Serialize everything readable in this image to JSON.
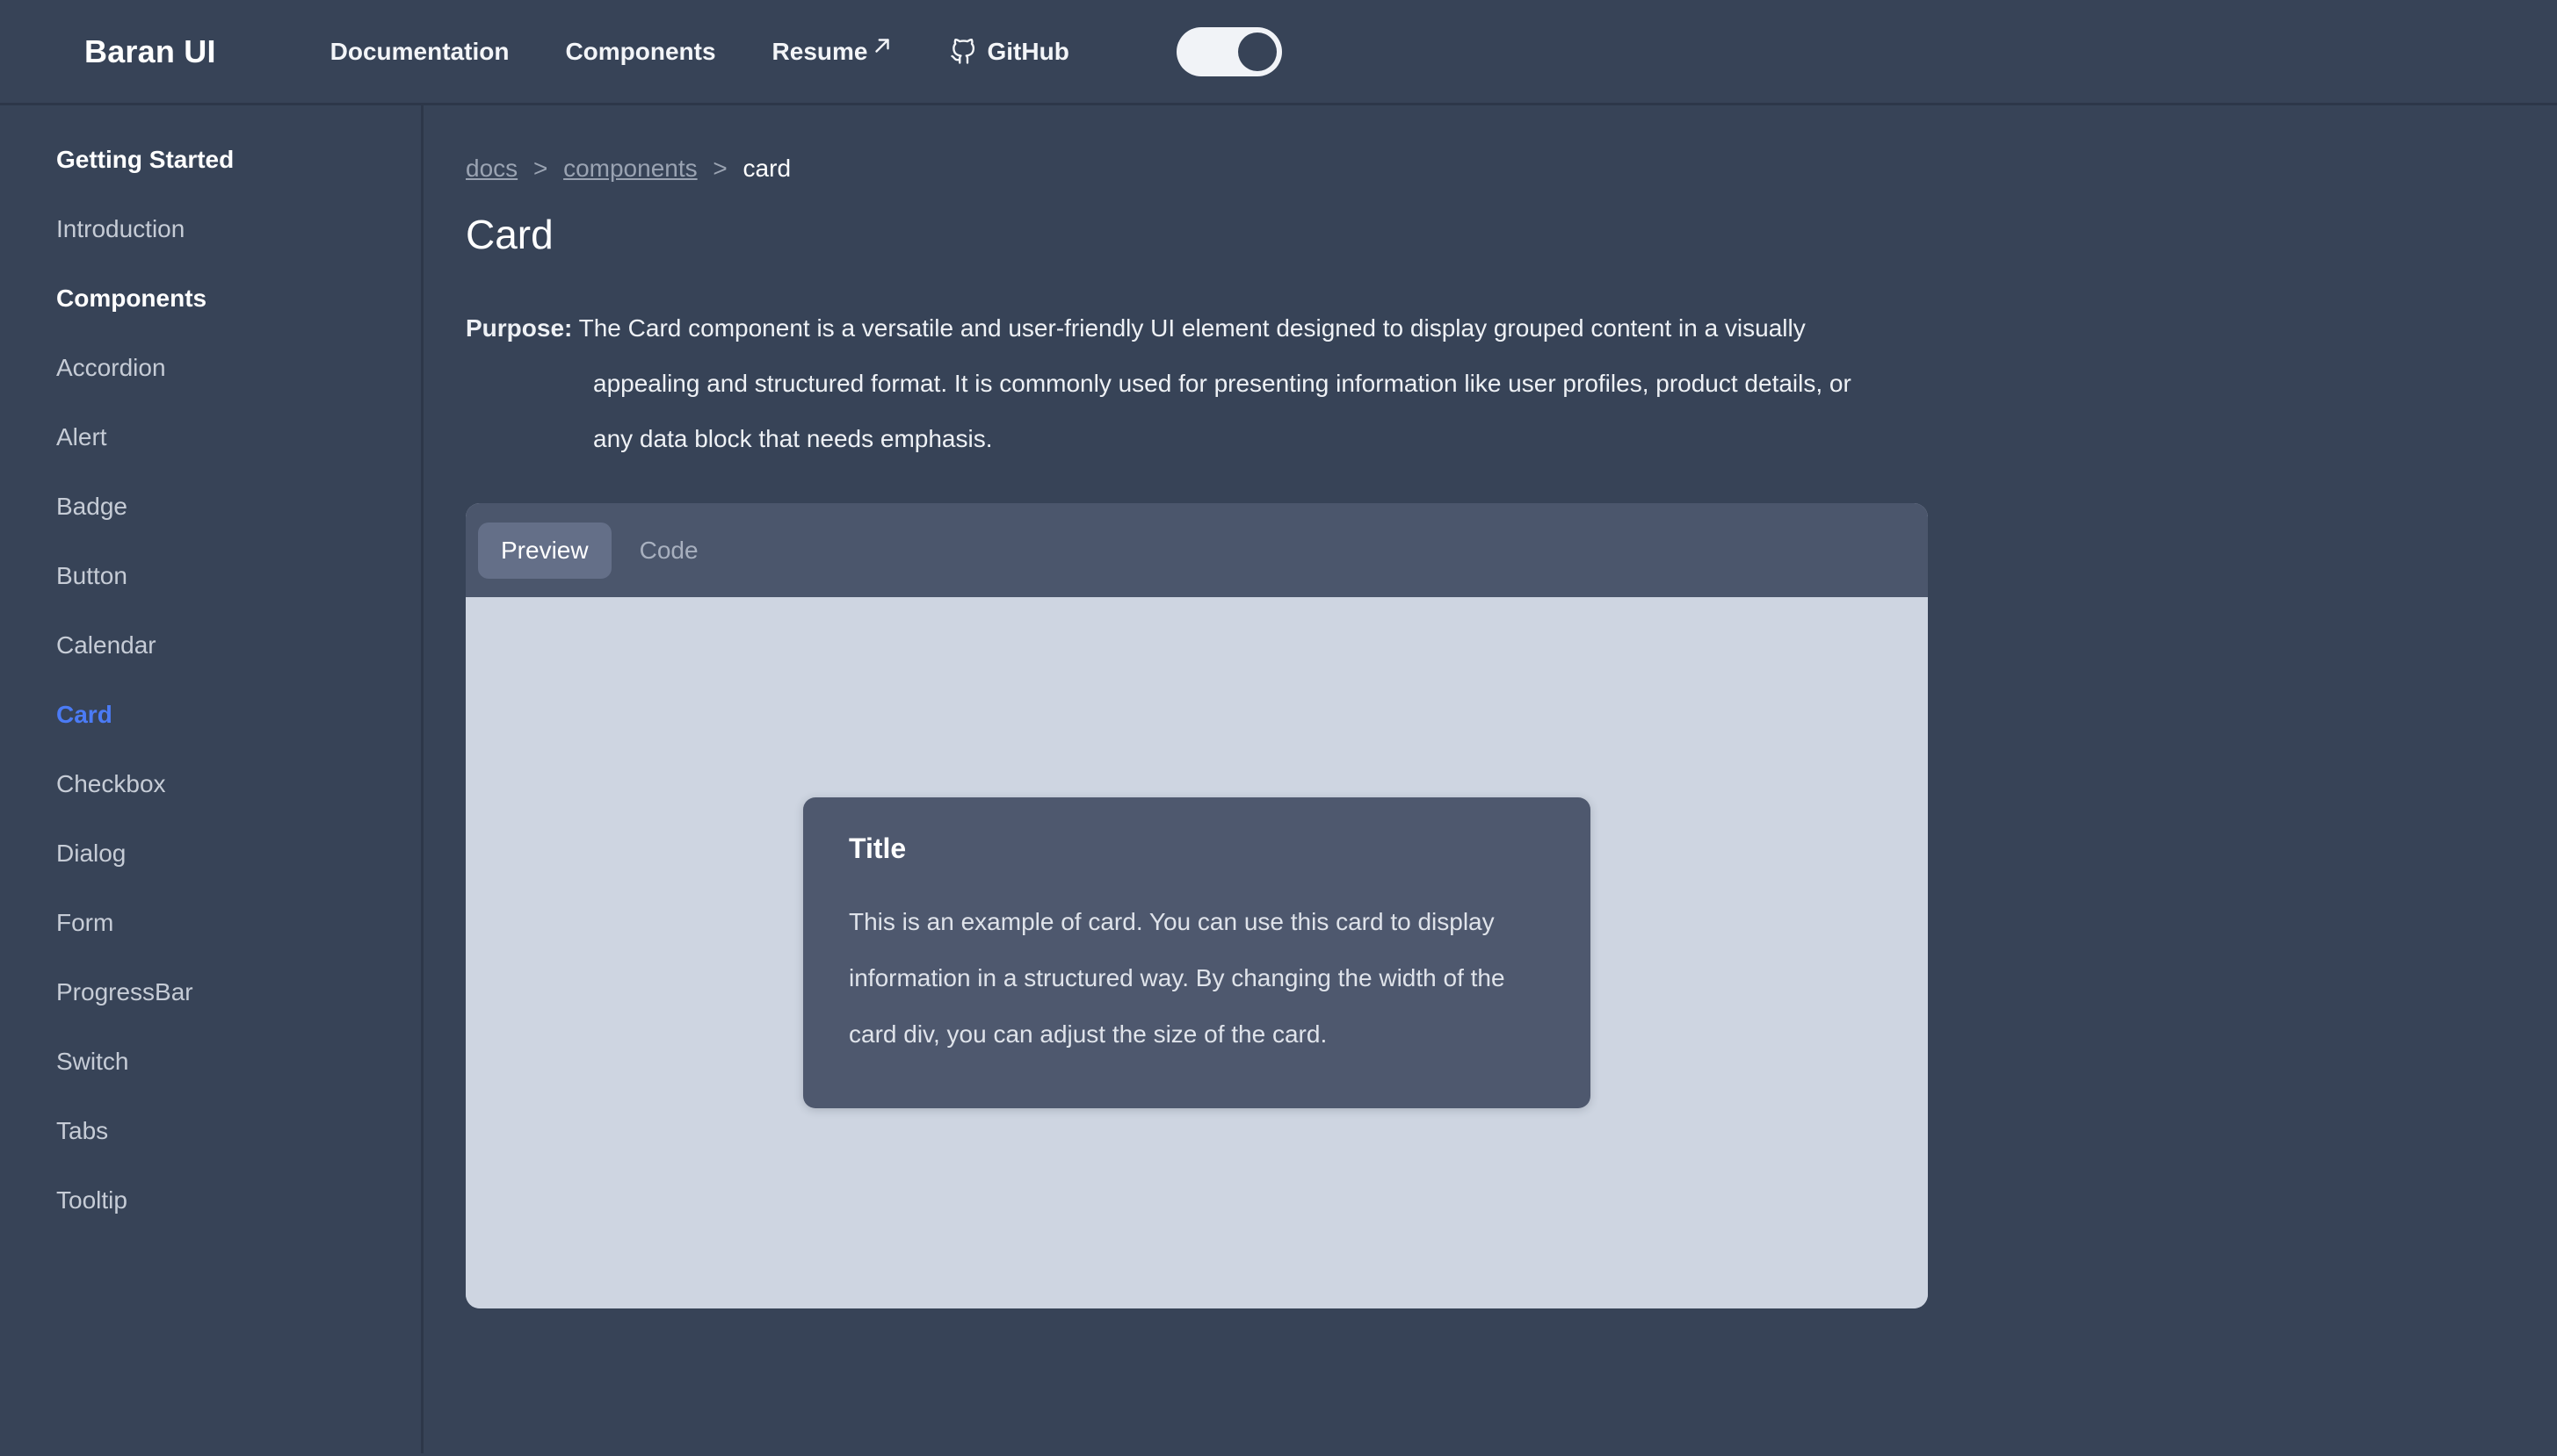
{
  "header": {
    "brand": "Baran UI",
    "nav": [
      {
        "label": "Documentation",
        "icon": null,
        "external": false
      },
      {
        "label": "Components",
        "icon": null,
        "external": false
      },
      {
        "label": "Resume",
        "icon": "external-link-arrow-icon",
        "external": true
      },
      {
        "label": "GitHub",
        "icon": "github-icon",
        "external": false
      }
    ],
    "theme_toggle": {
      "name": "theme-toggle",
      "state": "on",
      "knob_position": "right"
    }
  },
  "sidebar": {
    "items": [
      {
        "label": "Getting Started",
        "kind": "section",
        "active": false
      },
      {
        "label": "Introduction",
        "kind": "link",
        "active": false
      },
      {
        "label": "Components",
        "kind": "section",
        "active": false
      },
      {
        "label": "Accordion",
        "kind": "link",
        "active": false
      },
      {
        "label": "Alert",
        "kind": "link",
        "active": false
      },
      {
        "label": "Badge",
        "kind": "link",
        "active": false
      },
      {
        "label": "Button",
        "kind": "link",
        "active": false
      },
      {
        "label": "Calendar",
        "kind": "link",
        "active": false
      },
      {
        "label": "Card",
        "kind": "link",
        "active": true
      },
      {
        "label": "Checkbox",
        "kind": "link",
        "active": false
      },
      {
        "label": "Dialog",
        "kind": "link",
        "active": false
      },
      {
        "label": "Form",
        "kind": "link",
        "active": false
      },
      {
        "label": "ProgressBar",
        "kind": "link",
        "active": false
      },
      {
        "label": "Switch",
        "kind": "link",
        "active": false
      },
      {
        "label": "Tabs",
        "kind": "link",
        "active": false
      },
      {
        "label": "Tooltip",
        "kind": "link",
        "active": false
      }
    ]
  },
  "main": {
    "breadcrumb": [
      {
        "label": "docs",
        "current": false
      },
      {
        "label": "components",
        "current": false
      },
      {
        "label": "card",
        "current": true
      }
    ],
    "breadcrumb_separator": ">",
    "title": "Card",
    "purpose_label": "Purpose:",
    "purpose_text": " The Card component is a versatile and user-friendly UI element designed to display grouped content in a visually appealing and structured format. It is commonly used for presenting information like user profiles, product details, or any data block that needs emphasis.",
    "tabs": [
      {
        "label": "Preview",
        "active": true
      },
      {
        "label": "Code",
        "active": false
      }
    ],
    "preview": {
      "card": {
        "title": "Title",
        "body": "This is an example of card. You can use this card to display information in a structured way. By changing the width of the card div, you can adjust the size of the card."
      }
    }
  },
  "colors": {
    "page_background": "#374357",
    "divider": "#2d3749",
    "accent_active_link": "#4b7bf5",
    "panel_tabstrip": "#4b566c",
    "tab_active_background": "#646f88",
    "preview_stage": "#ced5e1",
    "demo_card_background": "#4e586e",
    "text_primary": "#ffffff",
    "text_muted": "#9aa3b2",
    "sidebar_link": "#c6ccd6"
  }
}
